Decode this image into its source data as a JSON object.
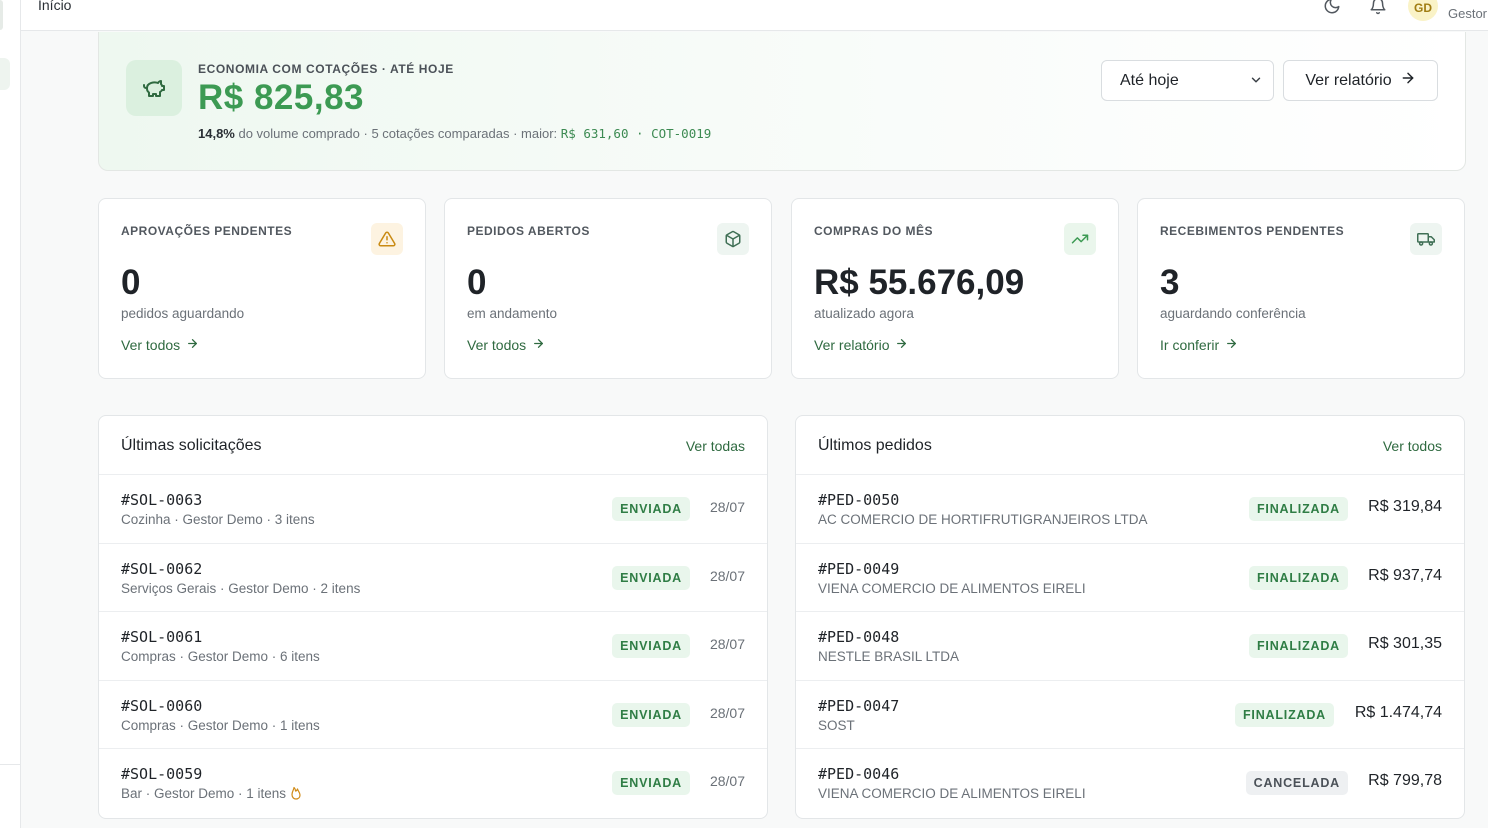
{
  "topbar": {
    "breadcrumb": "Início",
    "avatar_initials": "GD",
    "role": "Gestor"
  },
  "hero": {
    "kicker": "ECONOMIA COM COTAÇÕES · ATÉ HOJE",
    "amount": "R$ 825,83",
    "sub_pct": "14,8%",
    "sub_text": " do volume comprado · 5 cotações comparadas · maior: ",
    "sub_max": "R$ 631,60",
    "sub_sep": " · ",
    "sub_code": "COT-0019",
    "period_select": "Até hoje",
    "report_button": "Ver relatório",
    "colors": {
      "accent": "#3c9a53"
    }
  },
  "kpis": [
    {
      "title": "APROVAÇÕES PENDENTES",
      "value": "0",
      "sub": "pedidos aguardando",
      "link": "Ver todos",
      "icon": "warning-icon",
      "icon_bg": "#fdf3e1",
      "icon_color": "#c98a12"
    },
    {
      "title": "PEDIDOS ABERTOS",
      "value": "0",
      "sub": "em andamento",
      "link": "Ver todos",
      "icon": "package-icon",
      "icon_bg": "#eef5f1",
      "icon_color": "#3f6f55"
    },
    {
      "title": "COMPRAS DO MÊS",
      "value": "R$ 55.676,09",
      "sub": "atualizado agora",
      "link": "Ver relatório",
      "icon": "trending-up-icon",
      "icon_bg": "#eaf6ec",
      "icon_color": "#3c9a53"
    },
    {
      "title": "RECEBIMENTOS PENDENTES",
      "value": "3",
      "sub": "aguardando conferência",
      "link": "Ir conferir",
      "icon": "truck-icon",
      "icon_bg": "#eef5f1",
      "icon_color": "#3f6f55"
    }
  ],
  "requests": {
    "title": "Últimas solicitações",
    "link": "Ver todas",
    "rows": [
      {
        "id": "#SOL-0063",
        "sub": "Cozinha · Gestor Demo · 3 itens",
        "status": "ENVIADA",
        "date": "28/07"
      },
      {
        "id": "#SOL-0062",
        "sub": "Serviços Gerais · Gestor Demo · 2 itens",
        "status": "ENVIADA",
        "date": "28/07"
      },
      {
        "id": "#SOL-0061",
        "sub": "Compras · Gestor Demo · 6 itens",
        "status": "ENVIADA",
        "date": "28/07"
      },
      {
        "id": "#SOL-0060",
        "sub": "Compras · Gestor Demo · 1 itens",
        "status": "ENVIADA",
        "date": "28/07"
      },
      {
        "id": "#SOL-0059",
        "sub": "Bar · Gestor Demo · 1 itens",
        "status": "ENVIADA",
        "date": "28/07",
        "flag": "fire-icon"
      }
    ]
  },
  "orders": {
    "title": "Últimos pedidos",
    "link": "Ver todos",
    "rows": [
      {
        "id": "#PED-0050",
        "sub": "AC COMERCIO DE HORTIFRUTIGRANJEIROS LTDA",
        "status": "FINALIZADA",
        "amount": "R$ 319,84"
      },
      {
        "id": "#PED-0049",
        "sub": "VIENA COMERCIO DE ALIMENTOS EIRELI",
        "status": "FINALIZADA",
        "amount": "R$ 937,74"
      },
      {
        "id": "#PED-0048",
        "sub": "NESTLE BRASIL LTDA",
        "status": "FINALIZADA",
        "amount": "R$ 301,35"
      },
      {
        "id": "#PED-0047",
        "sub": "SOST",
        "status": "FINALIZADA",
        "amount": "R$ 1.474,74"
      },
      {
        "id": "#PED-0046",
        "sub": "VIENA COMERCIO DE ALIMENTOS EIRELI",
        "status": "CANCELADA",
        "amount": "R$ 799,78"
      }
    ]
  }
}
